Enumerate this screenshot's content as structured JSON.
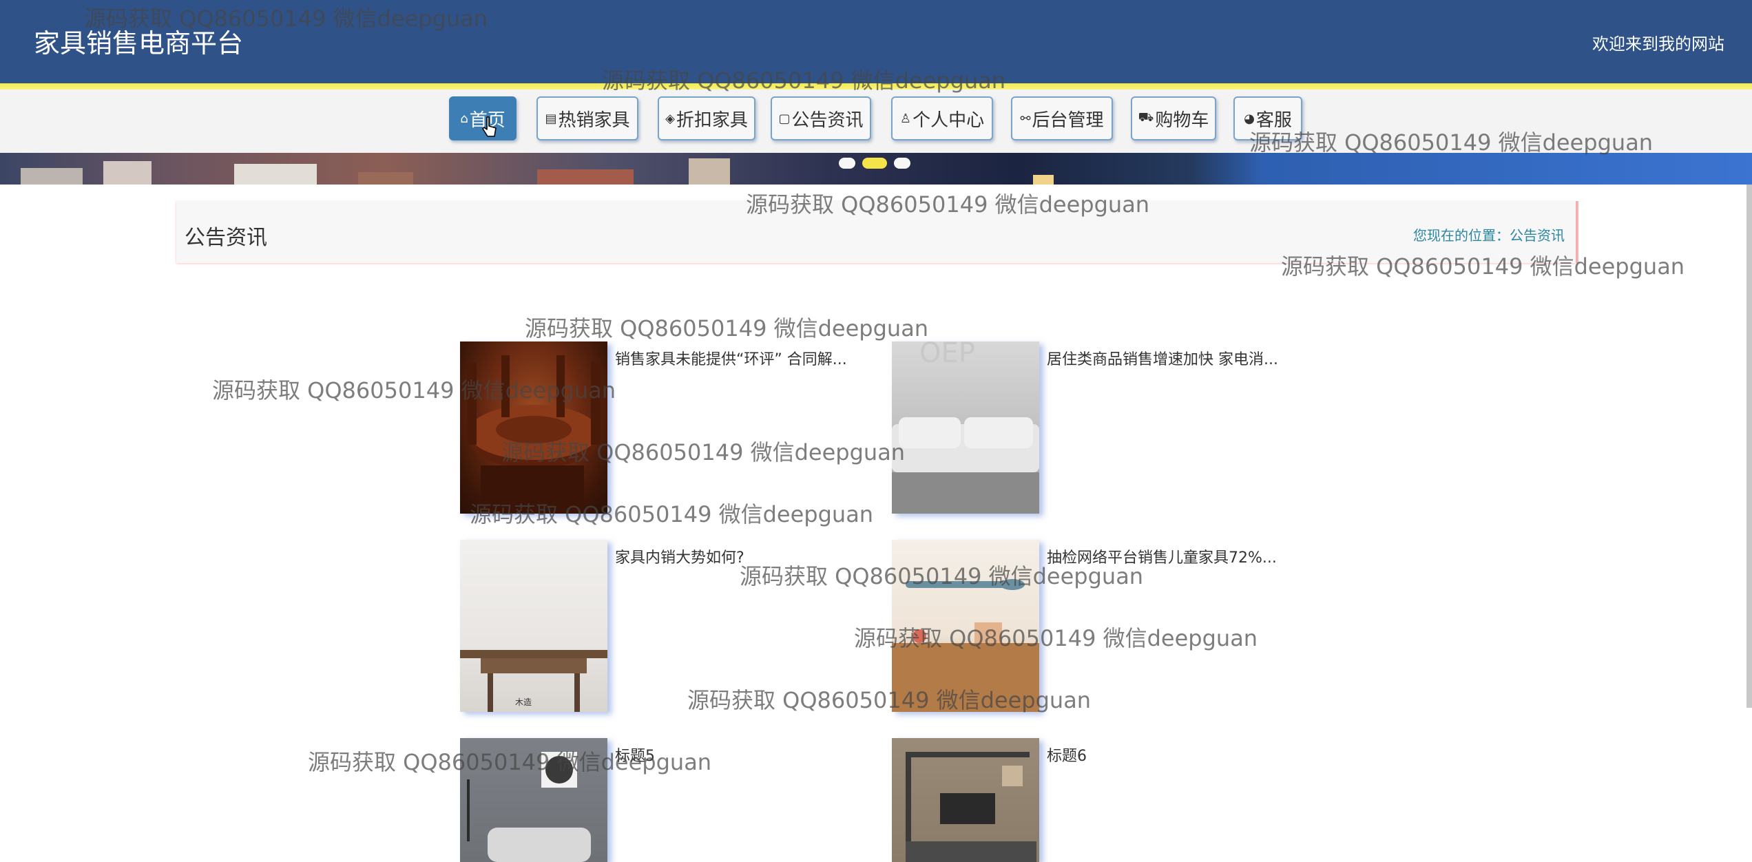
{
  "header": {
    "site_title": "家具销售电商平台",
    "welcome": "欢迎来到我的网站"
  },
  "nav": [
    {
      "label": "首页",
      "icon": "home-icon",
      "glyph": "⌂",
      "active": true
    },
    {
      "label": "热销家具",
      "icon": "gift-icon",
      "glyph": "▤",
      "active": false
    },
    {
      "label": "折扣家具",
      "icon": "layers-icon",
      "glyph": "◈",
      "active": false
    },
    {
      "label": "公告资讯",
      "icon": "message-icon",
      "glyph": "▢",
      "active": false
    },
    {
      "label": "个人中心",
      "icon": "user-icon",
      "glyph": "♙",
      "active": false
    },
    {
      "label": "后台管理",
      "icon": "link-icon",
      "glyph": "⚯",
      "active": false
    },
    {
      "label": "购物车",
      "icon": "cart-icon",
      "glyph": "⛟",
      "active": false
    },
    {
      "label": "客服",
      "icon": "chat-icon",
      "glyph": "◕",
      "active": false
    }
  ],
  "breadcrumb": {
    "title": "公告资讯",
    "here": "您现在的位置：公告资讯"
  },
  "news": [
    {
      "title": "销售家具未能提供“环评” 合同解..."
    },
    {
      "title": "居住类商品销售增速加快 家电消..."
    },
    {
      "title": "家具内销大势如何?"
    },
    {
      "title": "抽检网络平台销售儿童家具72%..."
    },
    {
      "title": "标题5"
    },
    {
      "title": "标题6"
    }
  ],
  "colors": {
    "header_bg": "#2f5389",
    "accent_yellow": "#f3ea4a",
    "active_nav": "#3d7fb4",
    "breadcrumb_link": "#2b86a2"
  },
  "watermark": "源码获取 QQ86050149 微信deepguan"
}
